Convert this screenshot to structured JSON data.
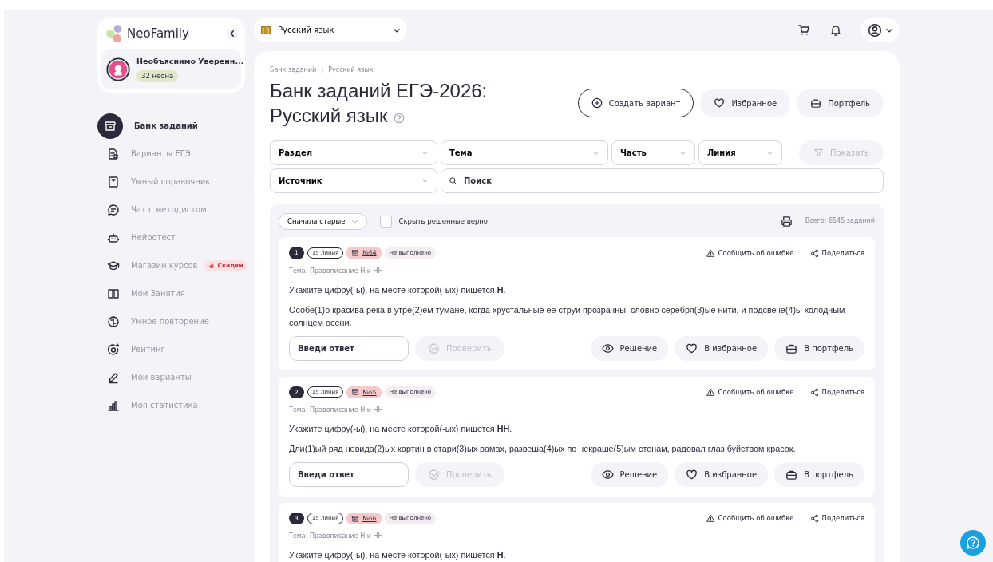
{
  "sidebar": {
    "logo": "NeoFamily",
    "user": {
      "name": "Необъяснимо Уверенн...",
      "balance": "32 неона"
    },
    "items": [
      {
        "label": "Банк заданий",
        "selected": true
      },
      {
        "label": "Варианты ЕГЭ",
        "selected": false
      },
      {
        "label": "Умный справочник",
        "selected": false
      },
      {
        "label": "Чат с методистом",
        "selected": false
      },
      {
        "label": "Нейротест",
        "selected": false
      },
      {
        "label": "Магазин курсов",
        "selected": false,
        "badge": "Скидки"
      },
      {
        "label": "Мои Занятия",
        "selected": false
      },
      {
        "label": "Умное повторение",
        "selected": false
      },
      {
        "label": "Рейтинг",
        "selected": false
      },
      {
        "label": "Мои варианты",
        "selected": false
      },
      {
        "label": "Моя статистика",
        "selected": false
      }
    ]
  },
  "topbar": {
    "subject": "Русский язык"
  },
  "breadcrumbs": [
    "Банк заданий",
    "Русский язык"
  ],
  "title_lines": [
    "Банк заданий ЕГЭ-2026:",
    "Русский язык"
  ],
  "header_buttons": [
    {
      "label": "Создать вариант",
      "kind": "outline"
    },
    {
      "label": "Избранное",
      "kind": "soft"
    },
    {
      "label": "Портфель",
      "kind": "soft"
    }
  ],
  "filters": {
    "selects": [
      {
        "placeholder": "Раздел"
      },
      {
        "placeholder": "Тема"
      },
      {
        "placeholder": "Часть"
      },
      {
        "placeholder": "Линия"
      }
    ],
    "show_button": {
      "label": "Показать",
      "disabled": true
    },
    "source": {
      "placeholder": "Источник"
    },
    "search": {
      "placeholder": "Поиск"
    }
  },
  "toolbar": {
    "sort": "Сначала старые",
    "hide_solved": {
      "label": "Скрыть решенные верно",
      "checked": false
    },
    "total": "Всего: 6545 заданий"
  },
  "tasks": [
    {
      "number": "1",
      "line": "15 линия",
      "ref": "№64",
      "status": "Не выполнено",
      "report": "Сообщить об ошибке",
      "share": "Поделиться",
      "topic": "Тема: Правописание Н и НН",
      "question": "Укажите цифру(-ы), на месте которой(-ых) пишется **Н**.",
      "text": "Особе(1)о красива река в утре(2)ем тумане, когда хрустальные её струи прозрачны, словно серебря(3)ые нити, и подсвече(4)ы холодным солнцем осени.",
      "answer_placeholder": "Введи ответ",
      "check_button": {
        "label": "Проверить",
        "disabled": true
      },
      "actions": [
        "Решение",
        "В избранное",
        "В портфель"
      ]
    },
    {
      "number": "2",
      "line": "15 линия",
      "ref": "№65",
      "status": "Не выполнено",
      "report": "Сообщить об ошибке",
      "share": "Поделиться",
      "topic": "Тема: Правописание Н и НН",
      "question": "Укажите цифру(-ы), на месте которой(-ых) пишется **НН**.",
      "text": "Дли(1)ый ряд невида(2)ых картин в стари(3)ых рамах, развеша(4)ых по некраше(5)ым стенам, радовал глаз буйством красок.",
      "answer_placeholder": "Введи ответ",
      "check_button": {
        "label": "Проверить",
        "disabled": true
      },
      "actions": [
        "Решение",
        "В избранное",
        "В портфель"
      ]
    },
    {
      "number": "3",
      "line": "15 линия",
      "ref": "№66",
      "status": "Не выполнено",
      "report": "Сообщить об ошибке",
      "share": "Поделиться",
      "topic": "Тема: Правописание Н и НН",
      "question": "Укажите цифру(-ы), на месте которой(-ых) пишется **Н**."
    }
  ]
}
